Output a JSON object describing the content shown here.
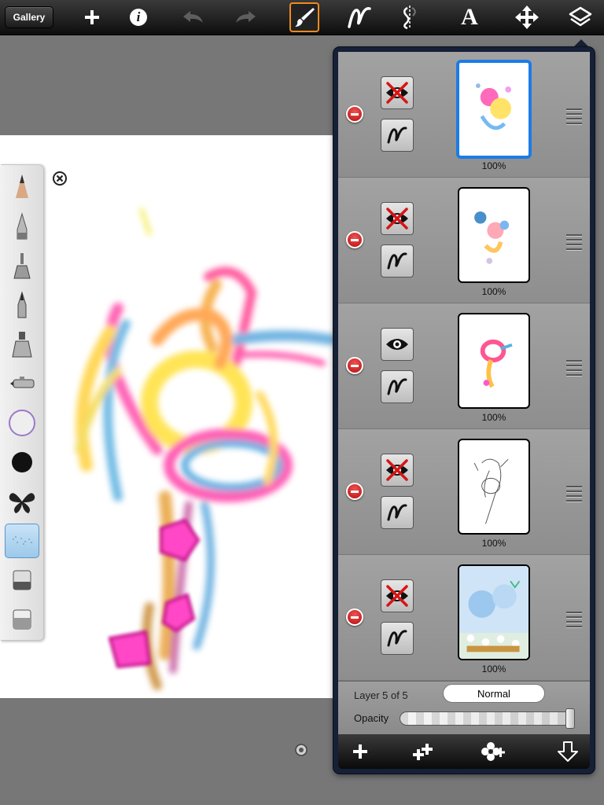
{
  "toolbar": {
    "gallery_label": "Gallery",
    "icons": [
      "add-icon",
      "info-icon",
      "undo-icon",
      "redo-icon",
      "brush-icon",
      "stroke-icon",
      "symmetry-icon",
      "text-icon",
      "transform-icon",
      "layers-icon"
    ],
    "active_tool": "brush",
    "text_tool_glyph": "A",
    "info_glyph": "i"
  },
  "brush_palette": {
    "brushes": [
      "pencil",
      "ballpoint-pen",
      "marker",
      "fine-pen",
      "felt-marker",
      "airbrush",
      "smudge",
      "solid-brush",
      "texture-brush",
      "dotted-brush",
      "eraser",
      "soft-eraser"
    ],
    "selected": "dotted-brush"
  },
  "layers": {
    "items": [
      {
        "name": "layer-5",
        "visible": false,
        "opacity_label": "100%",
        "selected": true
      },
      {
        "name": "layer-4",
        "visible": false,
        "opacity_label": "100%",
        "selected": false
      },
      {
        "name": "layer-3",
        "visible": true,
        "opacity_label": "100%",
        "selected": false
      },
      {
        "name": "layer-2",
        "visible": false,
        "opacity_label": "100%",
        "selected": false
      },
      {
        "name": "layer-1",
        "visible": false,
        "opacity_label": "100%",
        "selected": false
      }
    ],
    "layer_label": "Layer 5 of 5",
    "blend_mode": "Normal",
    "opacity_label": "Opacity",
    "opacity_value": 1.0,
    "bottom_icons": [
      "add-layer-icon",
      "duplicate-layer-icon",
      "add-image-layer-icon",
      "merge-down-icon"
    ]
  },
  "colors": {
    "accent_active": "#f08a1e",
    "selected_layer": "#1c7ce6",
    "delete_red": "#c81818"
  }
}
